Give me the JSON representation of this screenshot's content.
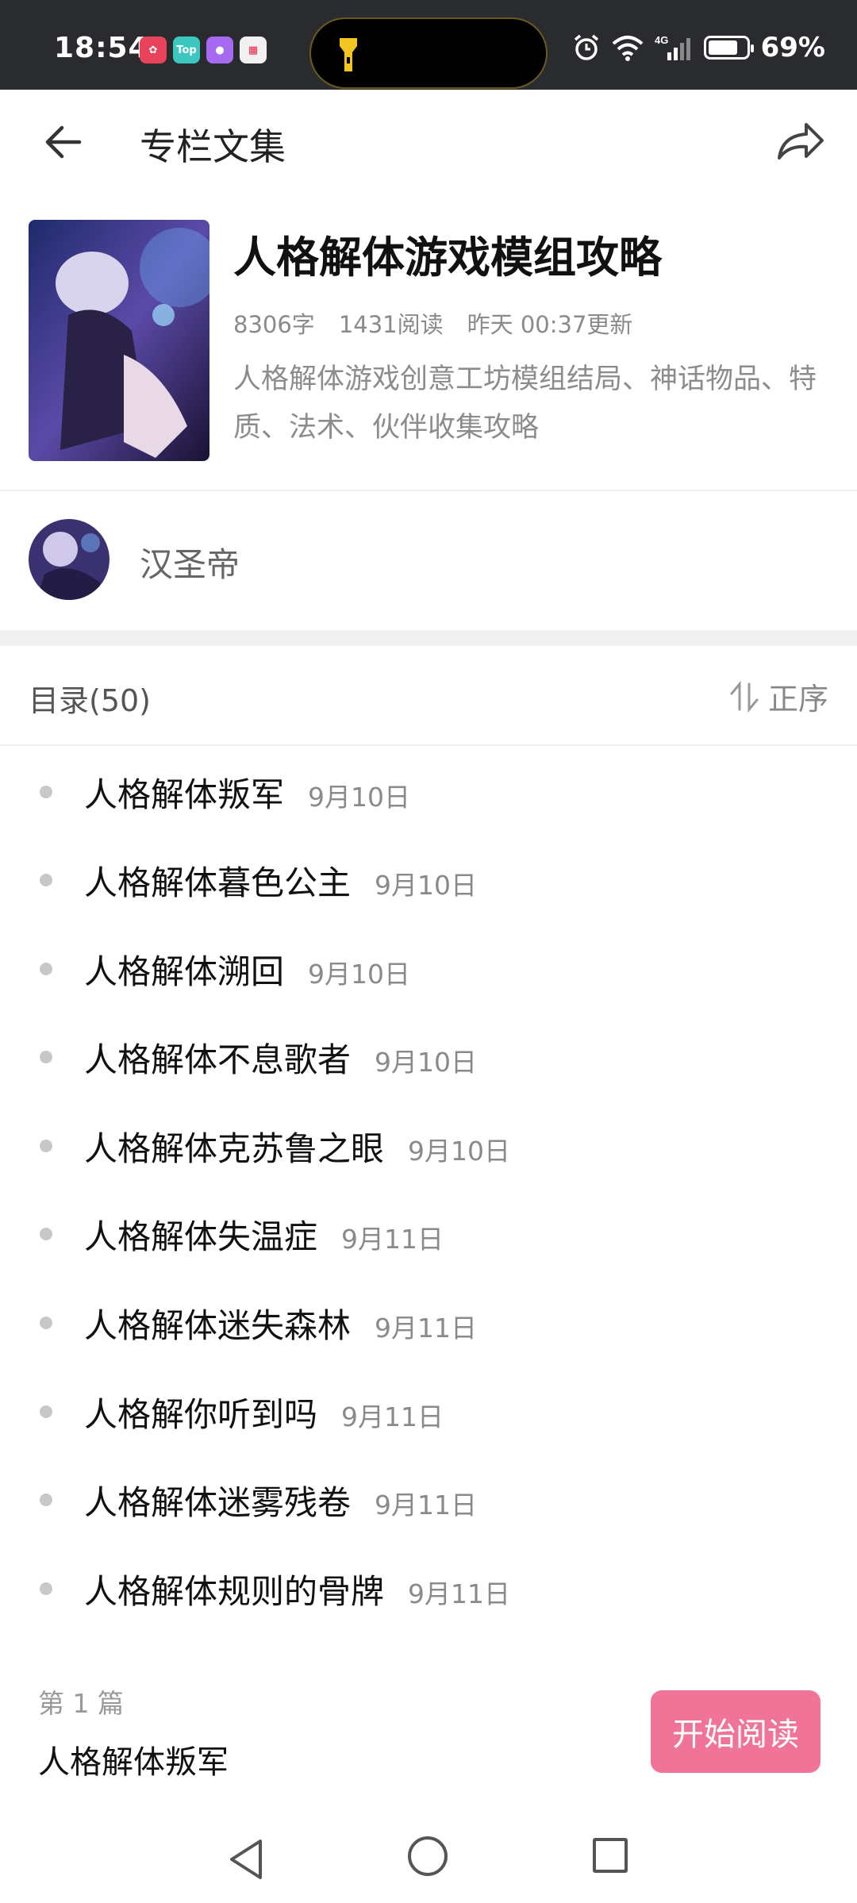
{
  "status_bar": {
    "time": "18:54",
    "app_icons": [
      "flower-app-icon",
      "top-app-icon",
      "bubble-app-icon",
      "calendar-app-icon"
    ],
    "network": "4G",
    "battery": "69%"
  },
  "header": {
    "title": "专栏文集"
  },
  "collection": {
    "title": "人格解体游戏模组攻略",
    "word_count": "8306字",
    "read_count": "1431阅读",
    "updated": "昨天 00:37更新",
    "description": "人格解体游戏创意工坊模组结局、神话物品、特质、法术、伙伴收集攻略"
  },
  "author": {
    "name": "汉圣帝"
  },
  "toc": {
    "label": "目录(50)",
    "sort_label": "正序",
    "items": [
      {
        "title": "人格解体叛军",
        "date": "9月10日"
      },
      {
        "title": "人格解体暮色公主",
        "date": "9月10日"
      },
      {
        "title": "人格解体溯回",
        "date": "9月10日"
      },
      {
        "title": "人格解体不息歌者",
        "date": "9月10日"
      },
      {
        "title": "人格解体克苏鲁之眼",
        "date": "9月10日"
      },
      {
        "title": "人格解体失温症",
        "date": "9月11日"
      },
      {
        "title": "人格解体迷失森林",
        "date": "9月11日"
      },
      {
        "title": "人格解你听到吗",
        "date": "9月11日"
      },
      {
        "title": "人格解体迷雾残卷",
        "date": "9月11日"
      },
      {
        "title": "人格解体规则的骨牌",
        "date": "9月11日"
      }
    ]
  },
  "bottom_bar": {
    "part_label": "第 1 篇",
    "part_title": "人格解体叛军",
    "start_button": "开始阅读"
  },
  "colors": {
    "accent": "#f07498",
    "status_bar_bg": "#2a2b2f"
  }
}
